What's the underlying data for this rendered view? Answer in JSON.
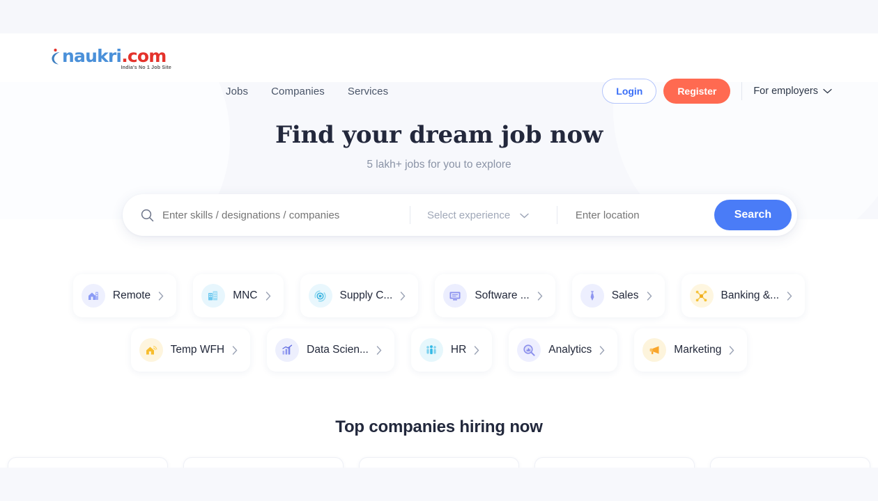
{
  "header": {
    "logo": {
      "name": "naukri",
      "domain": ".com",
      "tagline": "India's No 1 Job Site",
      "bird_icon": "bird-icon"
    },
    "nav": [
      {
        "label": "Jobs",
        "name": "nav-jobs"
      },
      {
        "label": "Companies",
        "name": "nav-companies"
      },
      {
        "label": "Services",
        "name": "nav-services"
      }
    ],
    "login_label": "Login",
    "register_label": "Register",
    "employers_label": "For employers",
    "employers_chevron": "chevron-down-icon",
    "colors": {
      "login_text": "#3a6ff7",
      "login_border": "#b4c5fb",
      "register_bg": "#ff6a51",
      "logo_blue": "#4a90d9",
      "logo_red": "#e4322b"
    }
  },
  "hero": {
    "title": "Find your dream job now",
    "subtitle": "5 lakh+ jobs for you to explore"
  },
  "search": {
    "search_icon": "search-icon",
    "skills_placeholder": "Enter skills / designations / companies",
    "skills_value": "",
    "experience_placeholder": "Select experience",
    "experience_value": "",
    "experience_chevron": "chevron-down-icon",
    "location_placeholder": "Enter location",
    "location_value": "",
    "button_label": "Search",
    "button_color": "#4a7cf7"
  },
  "chips": {
    "arrow_icon": "chevron-right-icon",
    "row1": [
      {
        "label": "Remote",
        "icon": "remote-home-icon",
        "icon_bg": "#eef0fe",
        "icon_color": "#8b9bf5"
      },
      {
        "label": "MNC",
        "icon": "office-building-icon",
        "icon_bg": "#e7f6fd",
        "icon_color": "#6cc8ef"
      },
      {
        "label": "Supply C...",
        "full_label": "Supply Chain",
        "icon": "supply-chain-icon",
        "icon_bg": "#e9f7fd",
        "icon_color": "#54bde5"
      },
      {
        "label": "Software ...",
        "full_label": "Software & IT",
        "icon": "monitor-icon",
        "icon_bg": "#eceefe",
        "icon_color": "#8b92ee"
      },
      {
        "label": "Sales",
        "icon": "necktie-icon",
        "icon_bg": "#edeffe",
        "icon_color": "#8e96f0"
      },
      {
        "label": "Banking &...",
        "full_label": "Banking & Finance",
        "icon": "network-nodes-icon",
        "icon_bg": "#fef6e0",
        "icon_color": "#f5c33c"
      }
    ],
    "row2": [
      {
        "label": "Temp WFH",
        "icon": "home-signal-icon",
        "icon_bg": "#fef5de",
        "icon_color": "#f7bd2e"
      },
      {
        "label": "Data Scien...",
        "full_label": "Data Science",
        "icon": "bar-chart-up-icon",
        "icon_bg": "#edeffd",
        "icon_color": "#8d96ef"
      },
      {
        "label": "HR",
        "icon": "people-group-icon",
        "icon_bg": "#e6f7fc",
        "icon_color": "#5ac6e8"
      },
      {
        "label": "Analytics",
        "icon": "magnifier-chart-icon",
        "icon_bg": "#eeefff",
        "icon_color": "#8b8fec"
      },
      {
        "label": "Marketing",
        "icon": "megaphone-icon",
        "icon_bg": "#fdf4dc",
        "icon_color": "#f9a62b"
      }
    ]
  },
  "companies": {
    "title": "Top companies hiring now",
    "cards": [
      {},
      {},
      {},
      {},
      {}
    ]
  }
}
